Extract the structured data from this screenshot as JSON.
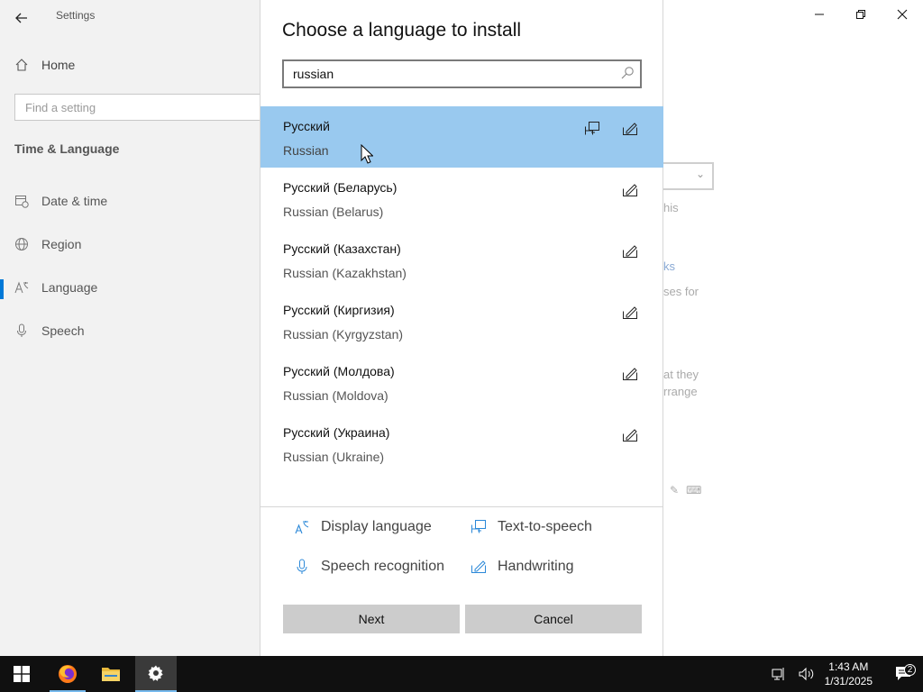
{
  "settings_window": {
    "title": "Settings",
    "home_label": "Home",
    "search_placeholder": "Find a setting",
    "section_heading": "Time & Language",
    "nav_items": [
      {
        "label": "Date & time",
        "icon": "calendar-clock-icon"
      },
      {
        "label": "Region",
        "icon": "globe-icon"
      },
      {
        "label": "Language",
        "icon": "language-icon"
      },
      {
        "label": "Speech",
        "icon": "microphone-icon"
      }
    ],
    "active_nav": "Language",
    "background_text": {
      "t1": "his",
      "t2": "ks",
      "t3": "ses for",
      "t4": "at they",
      "t5": "rrange"
    }
  },
  "dialog": {
    "title": "Choose a language to install",
    "search_value": "russian",
    "languages": [
      {
        "native": "Русский",
        "english": "Russian",
        "features": [
          "text-to-speech",
          "handwriting"
        ],
        "selected": true
      },
      {
        "native": "Русский (Беларусь)",
        "english": "Russian (Belarus)",
        "features": [
          "handwriting"
        ],
        "selected": false
      },
      {
        "native": "Русский (Казахстан)",
        "english": "Russian (Kazakhstan)",
        "features": [
          "handwriting"
        ],
        "selected": false
      },
      {
        "native": "Русский (Киргизия)",
        "english": "Russian (Kyrgyzstan)",
        "features": [
          "handwriting"
        ],
        "selected": false
      },
      {
        "native": "Русский (Молдова)",
        "english": "Russian (Moldova)",
        "features": [
          "handwriting"
        ],
        "selected": false
      },
      {
        "native": "Русский (Украина)",
        "english": "Russian (Ukraine)",
        "features": [
          "handwriting"
        ],
        "selected": false
      }
    ],
    "legend": {
      "display_language": "Display language",
      "text_to_speech": "Text-to-speech",
      "speech_recognition": "Speech recognition",
      "handwriting": "Handwriting"
    },
    "next_label": "Next",
    "cancel_label": "Cancel"
  },
  "taskbar": {
    "time": "1:43 AM",
    "date": "1/31/2025",
    "notification_count": "2",
    "apps": [
      "start-icon",
      "firefox-icon",
      "file-explorer-icon",
      "settings-gear-icon"
    ]
  },
  "colors": {
    "selection": "#99c9ef",
    "accent": "#0078d7",
    "button": "#cccccc",
    "taskbar": "#101010"
  }
}
